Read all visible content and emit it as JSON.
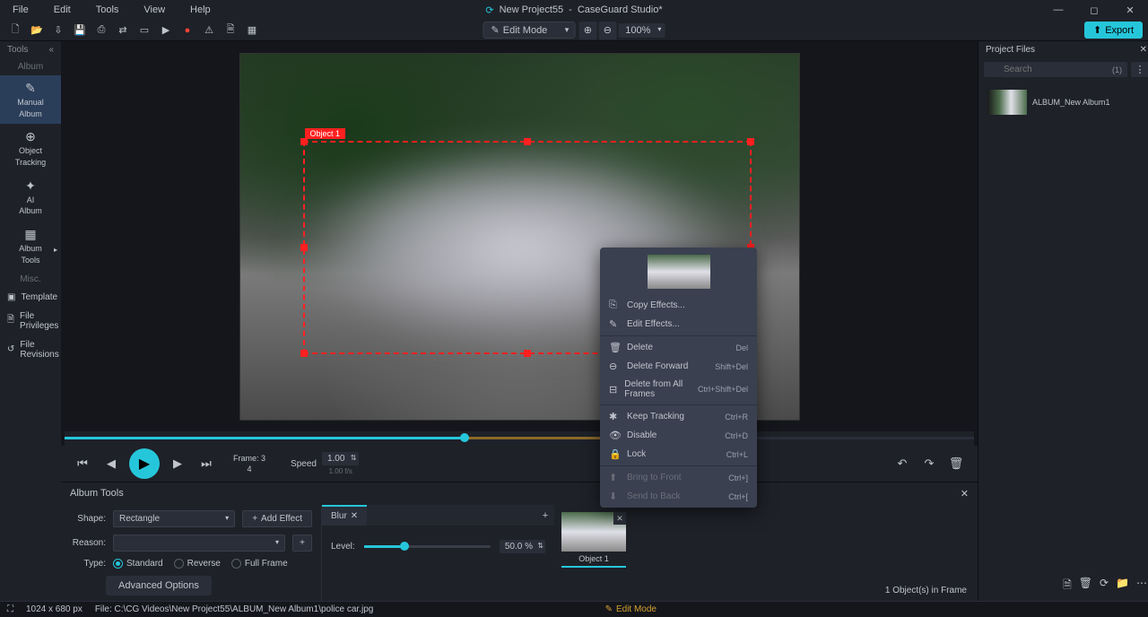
{
  "title": {
    "project": "New Project55",
    "app": "CaseGuard Studio*"
  },
  "menubar": [
    "File",
    "Edit",
    "Tools",
    "View",
    "Help"
  ],
  "export_label": "Export",
  "mode": {
    "label": "Edit Mode",
    "zoom": "100%"
  },
  "sidebar": {
    "header": "Tools",
    "album_label": "Album",
    "items": [
      {
        "icon": "✎",
        "line1": "Manual",
        "line2": "Album"
      },
      {
        "icon": "⊕",
        "line1": "Object",
        "line2": "Tracking"
      },
      {
        "icon": "✦",
        "line1": "AI",
        "line2": "Album"
      },
      {
        "icon": "▦",
        "line1": "Album",
        "line2": "Tools",
        "caret": true
      }
    ],
    "misc_label": "Misc.",
    "misc": [
      {
        "icon": "▣",
        "label": "Template"
      },
      {
        "icon": "🗎",
        "label": "File Privileges"
      },
      {
        "icon": "↺",
        "label": "File Revisions"
      }
    ]
  },
  "selection": {
    "label": "Object 1"
  },
  "context": [
    {
      "icon": "⎘",
      "label": "Copy Effects...",
      "shortcut": ""
    },
    {
      "icon": "✎",
      "label": "Edit Effects...",
      "shortcut": ""
    },
    {
      "sep": true
    },
    {
      "icon": "🗑",
      "label": "Delete",
      "shortcut": "Del"
    },
    {
      "icon": "⊖",
      "label": "Delete Forward",
      "shortcut": "Shift+Del"
    },
    {
      "icon": "⊟",
      "label": "Delete from All Frames",
      "shortcut": "Ctrl+Shift+Del"
    },
    {
      "sep": true
    },
    {
      "icon": "✱",
      "label": "Keep Tracking",
      "shortcut": "Ctrl+R"
    },
    {
      "icon": "👁",
      "label": "Disable",
      "shortcut": "Ctrl+D"
    },
    {
      "icon": "🔒",
      "label": "Lock",
      "shortcut": "Ctrl+L"
    },
    {
      "sep": true
    },
    {
      "icon": "⬆",
      "label": "Bring to Front",
      "shortcut": "Ctrl+]",
      "disabled": true
    },
    {
      "icon": "⬇",
      "label": "Send to Back",
      "shortcut": "Ctrl+[",
      "disabled": true
    }
  ],
  "transport": {
    "frame_label": "Frame:",
    "frame_current": "3",
    "frame_total": "4",
    "speed_label": "Speed",
    "speed_val": "1.00",
    "speed_unit": "1.00 f/s"
  },
  "album_tools": {
    "title": "Album Tools",
    "shape_label": "Shape:",
    "shape_val": "Rectangle",
    "add_effect": "Add Effect",
    "reason_label": "Reason:",
    "type_label": "Type:",
    "types": [
      "Standard",
      "Reverse",
      "Full Frame"
    ],
    "adv": "Advanced Options",
    "tab": "Blur",
    "level_label": "Level:",
    "level_val": "50.0 %",
    "object_label": "Object 1",
    "frame_count": "1 Object(s) in Frame"
  },
  "statusbar": {
    "dims": "1024 x 680 px",
    "file": "File: C:\\CG Videos\\New Project55\\ALBUM_New Album1\\police car.jpg",
    "mode": "Edit Mode"
  },
  "project_files": {
    "title": "Project Files",
    "search_placeholder": "Search",
    "search_count": "(1)",
    "album": "ALBUM_New Album1"
  }
}
